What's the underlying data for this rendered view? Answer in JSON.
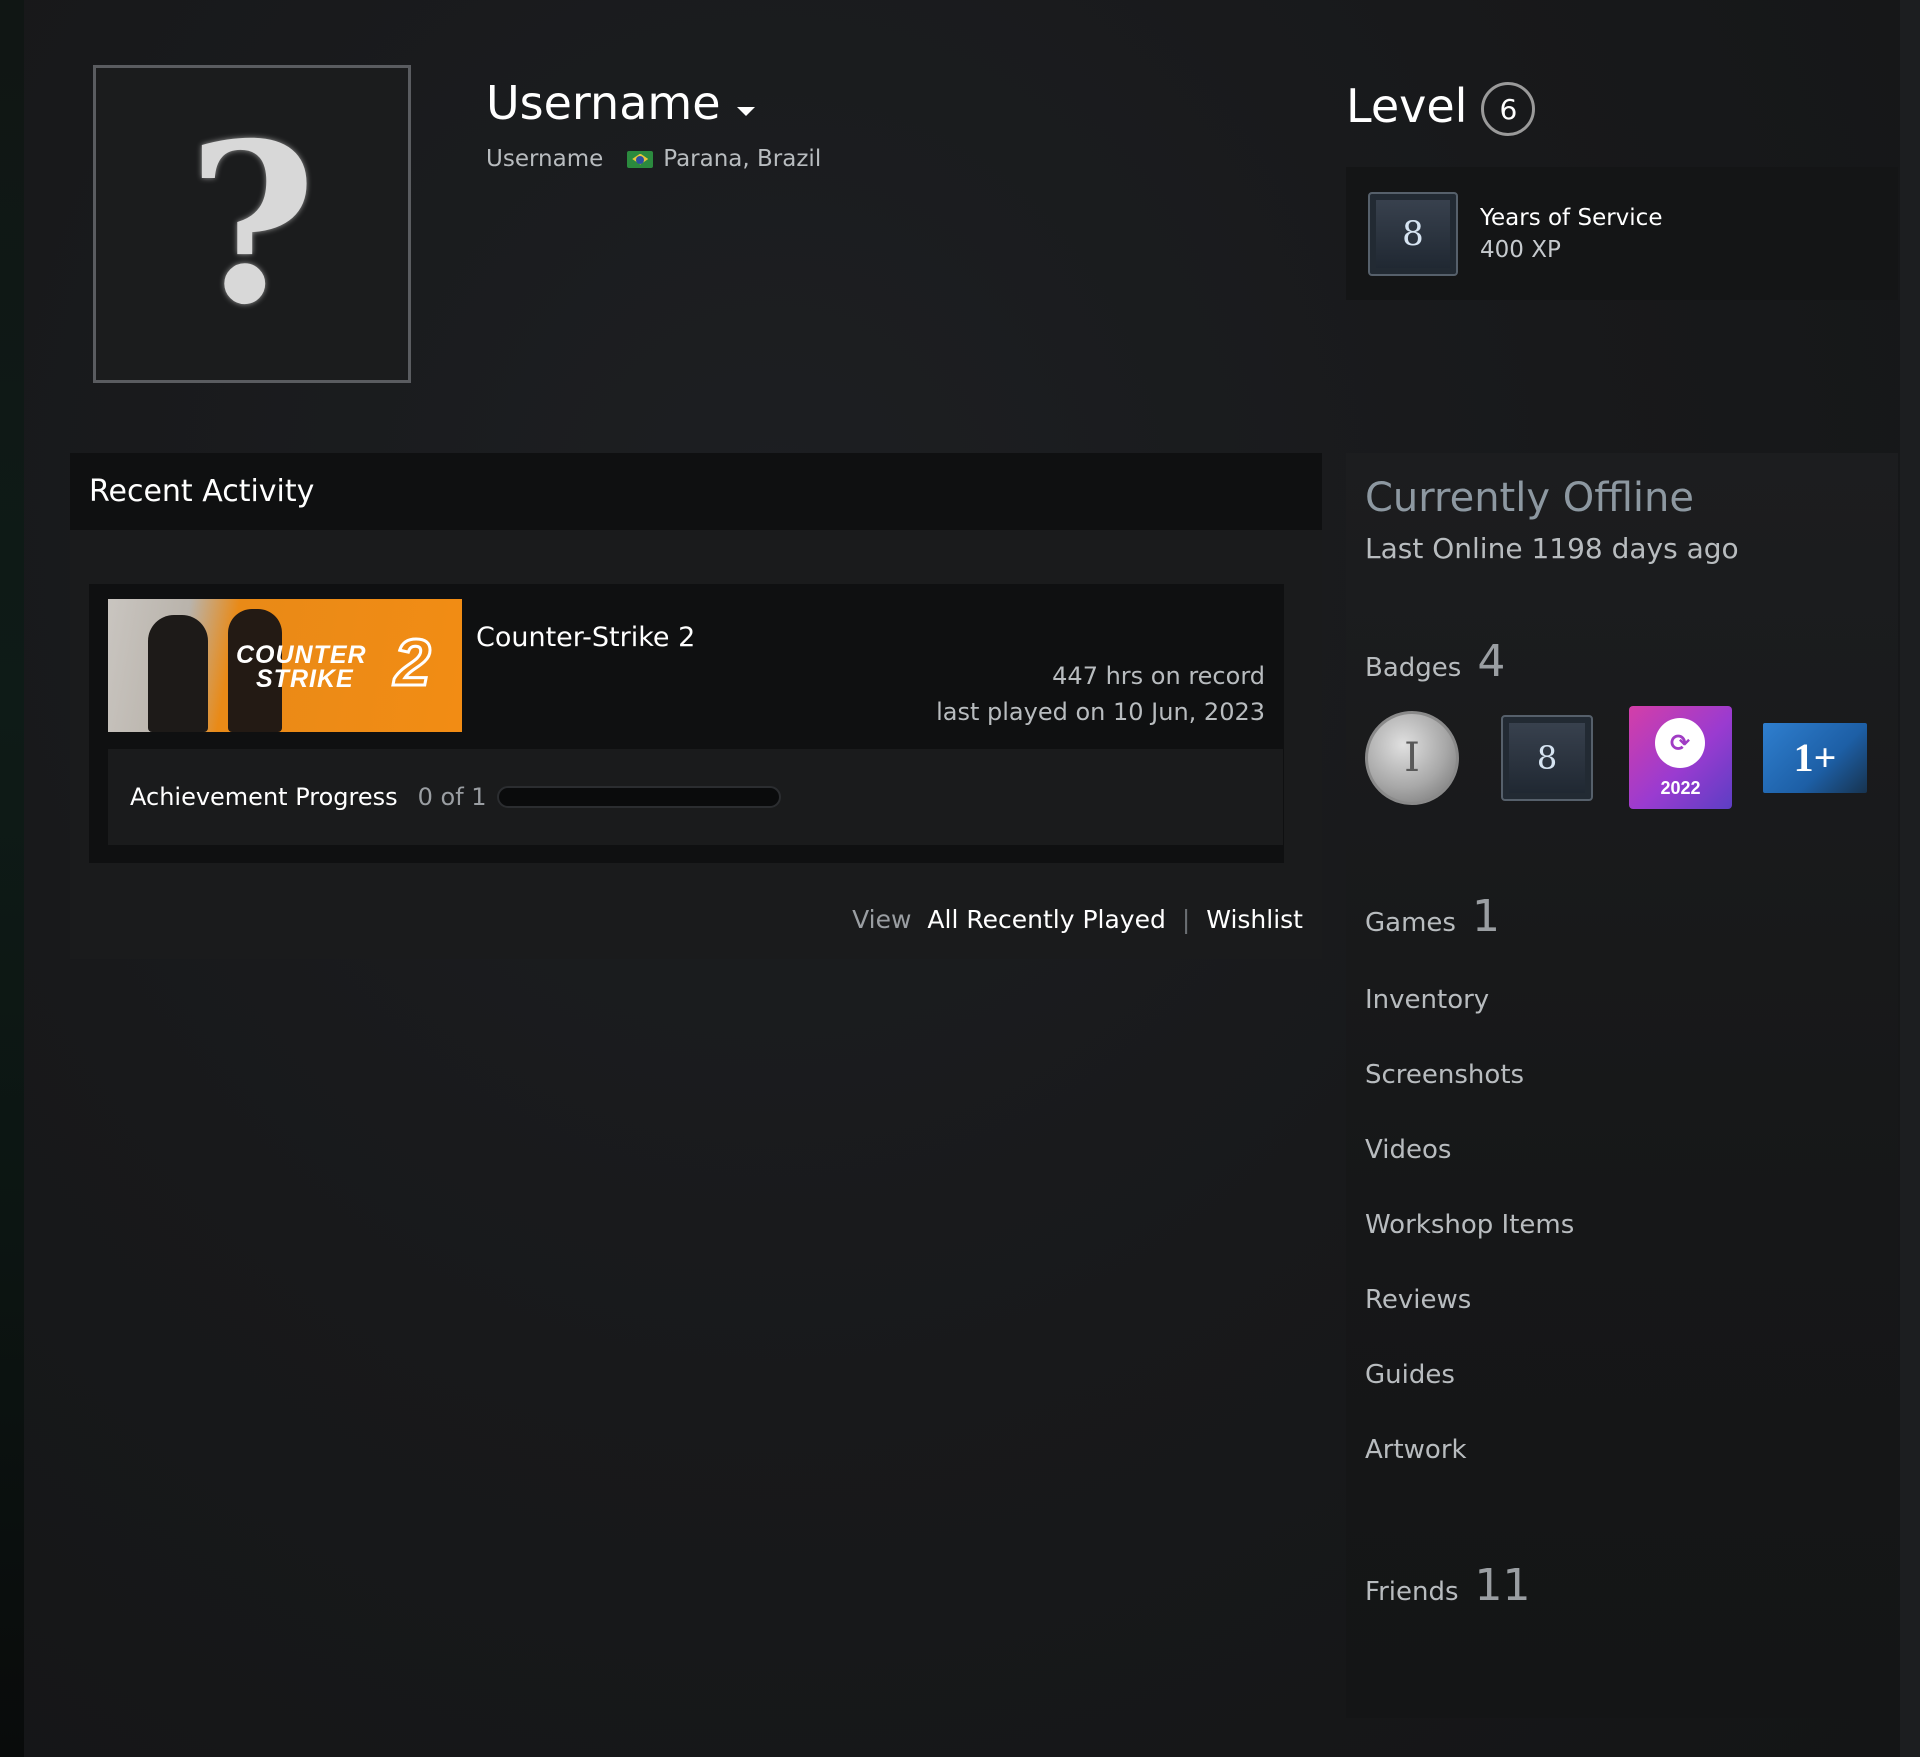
{
  "profile": {
    "avatar_glyph": "?",
    "persona_name": "Username",
    "real_name": "Username",
    "location": "Parana, Brazil",
    "flag_icon": "brazil-flag-icon"
  },
  "level": {
    "label": "Level",
    "value": "6"
  },
  "featured_badge": {
    "icon_glyph": "8",
    "title": "Years of Service",
    "xp": "400 XP"
  },
  "recent_activity": {
    "title": "Recent Activity",
    "game": {
      "name": "Counter-Strike 2",
      "capsule_line1": "COUNTER",
      "capsule_line2": "STRIKE",
      "capsule_number": "2",
      "hours": "447 hrs on record",
      "last_played": "last played on 10 Jun, 2023",
      "achievement_label": "Achievement Progress",
      "achievement_count": "0 of 1",
      "achievement_progress": 0
    },
    "view_label": "View",
    "all_recently_played": "All Recently Played",
    "separator": "|",
    "wishlist": "Wishlist"
  },
  "sidebar": {
    "status": "Currently Offline",
    "last_online": "Last Online 1198 days ago",
    "badges_label": "Badges",
    "badges_count": "4",
    "badges": [
      {
        "name": "pillar-badge-icon",
        "glyph": "Ⅰ"
      },
      {
        "name": "years-of-service-badge-icon",
        "glyph": "8"
      },
      {
        "name": "steam-2022-badge-icon",
        "glyph": "⟳",
        "year": "2022"
      },
      {
        "name": "one-plus-badge-icon",
        "glyph": "1+"
      }
    ],
    "games_label": "Games",
    "games_count": "1",
    "links": [
      "Inventory",
      "Screenshots",
      "Videos",
      "Workshop Items",
      "Reviews",
      "Guides",
      "Artwork"
    ],
    "friends_label": "Friends",
    "friends_count": "11"
  },
  "colors": {
    "background": "#161718",
    "panel_dark": "#0f1011",
    "text_bright": "#ffffff",
    "text_muted": "#b8bcbf",
    "capsule_orange": "#f28c14",
    "badge_purple": "#9a3bd0"
  }
}
